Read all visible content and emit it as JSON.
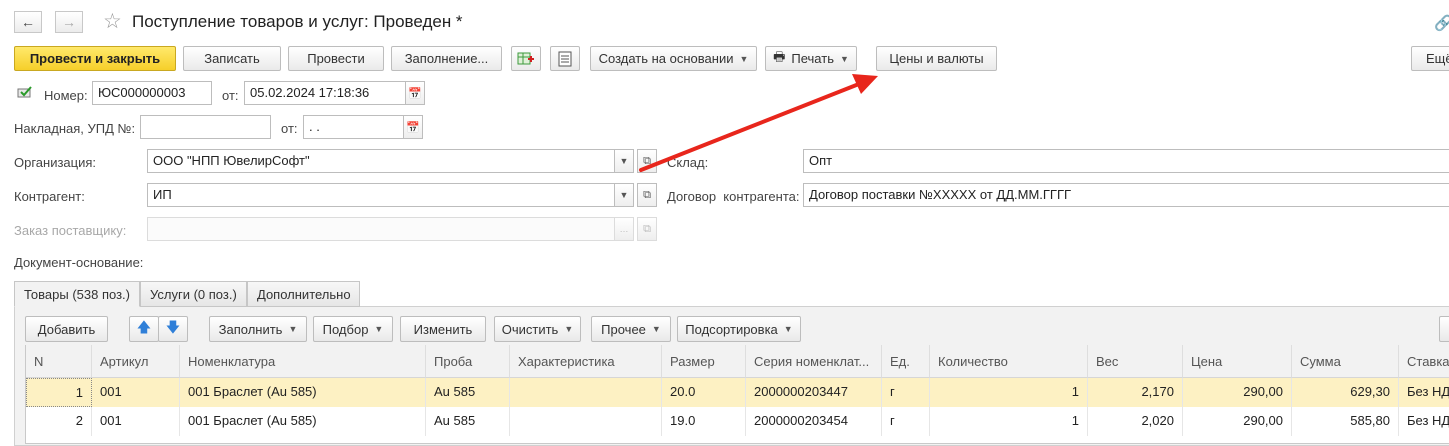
{
  "window": {
    "title": "Поступление товаров и услуг: Проведен *"
  },
  "toolbar": {
    "post_close": "Провести и закрыть",
    "save": "Записать",
    "post": "Провести",
    "fill": "Заполнение...",
    "create_based": "Создать на основании",
    "print": "Печать",
    "prices": "Цены и валюты",
    "more": "Ещё"
  },
  "header": {
    "number_label": "Номер:",
    "number_value": "ЮС000000003",
    "from_label": "от:",
    "date_value": "05.02.2024 17:18:36",
    "invoice_label": "Накладная, УПД №:",
    "invoice_value": "",
    "invoice_from_label": "от:",
    "invoice_date_value": " .  .",
    "org_label": "Организация:",
    "org_value": "ООО \"НПП ЮвелирСофт\"",
    "warehouse_label": "Склад:",
    "warehouse_value": "Опт",
    "counterparty_label": "Контрагент:",
    "counterparty_value": "ИП",
    "contract_label": "Договор  контрагента:",
    "contract_value": "Договор поставки №ХХХХХ от ДД.ММ.ГГГГ",
    "order_label": "Заказ поставщику:",
    "order_value": "",
    "base_doc_label": "Документ-основание:"
  },
  "tabs": [
    {
      "label": "Товары (538 поз.)"
    },
    {
      "label": "Услуги (0 поз.)"
    },
    {
      "label": "Дополнительно"
    }
  ],
  "table_toolbar": {
    "add": "Добавить",
    "fill": "Заполнить",
    "pick": "Подбор",
    "edit": "Изменить",
    "clear": "Очистить",
    "other": "Прочее",
    "sort": "Подсортировка"
  },
  "table": {
    "columns": [
      "N",
      "Артикул",
      "Номенклатура",
      "Проба",
      "Характеристика",
      "Размер",
      "Серия номенклат...",
      "Ед.",
      "Количество",
      "Вес",
      "Цена",
      "Сумма",
      "Ставка НДС"
    ],
    "rows": [
      [
        "1",
        "001",
        "001 Браслет (Au 585)",
        "Au 585",
        "",
        "20.0",
        "2000000203447",
        "г",
        "1",
        "2,170",
        "290,00",
        "629,30",
        "Без НДС"
      ],
      [
        "2",
        "001",
        "001 Браслет (Au 585)",
        "Au 585",
        "",
        "19.0",
        "2000000203454",
        "г",
        "1",
        "2,020",
        "290,00",
        "585,80",
        "Без НДС"
      ]
    ]
  },
  "colors": {
    "accent_yellow": "#f6cf2a",
    "selected_row": "#fdf1c3",
    "annotation_arrow": "#e8261c"
  }
}
